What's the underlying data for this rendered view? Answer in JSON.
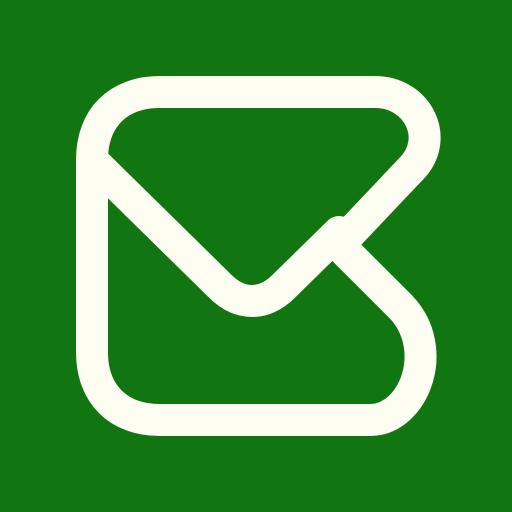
{
  "icon": {
    "name": "mail-envelope-icon",
    "colors": {
      "background": "#117512",
      "foreground": "#FDFDF1"
    }
  }
}
